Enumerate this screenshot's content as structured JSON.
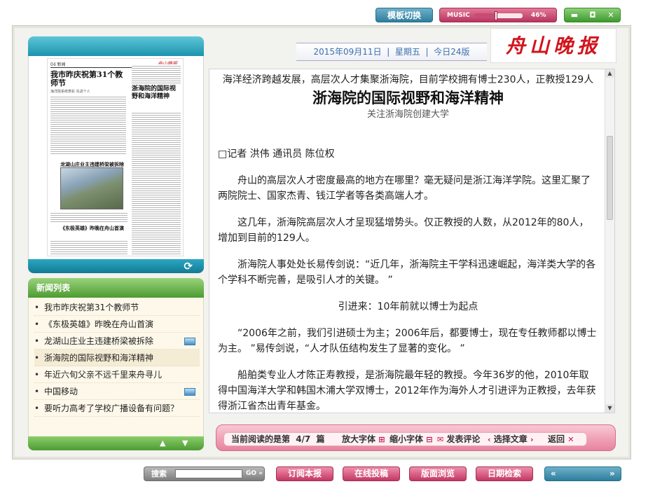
{
  "topbar": {
    "template_switch": "模板切换",
    "music_label": "MUSIC",
    "music_volume_text": "46%",
    "music_volume": 0.46,
    "win_minimize": "▬",
    "win_restore": "◘",
    "win_close": "✕"
  },
  "masthead": {
    "date": "2015年09月11日",
    "weekday": "星期五",
    "edition": "今日24版",
    "logo_text": "舟山晚报"
  },
  "thumbnail": {
    "page_label": "04 新闻",
    "headline": "我市昨庆祝第31个教师节",
    "subtitle": "海洋院系统表彰 先进个人",
    "side_headline": "浙海院的国际视野和海洋精神",
    "photo_caption": "龙湖山庄业主违建桥梁被拆除",
    "bottom_headline": "《东极英雄》昨晚在舟山首演",
    "refresh_icon": "⟳"
  },
  "news_list": {
    "title": "新闻列表",
    "items": [
      {
        "text": "我市昨庆祝第31个教师节",
        "has_image": false
      },
      {
        "text": "《东极英雄》昨晚在舟山首演",
        "has_image": false
      },
      {
        "text": "龙湖山庄业主违建桥梁被拆除",
        "has_image": true
      },
      {
        "text": "浙海院的国际视野和海洋精神",
        "has_image": false
      },
      {
        "text": "年近六旬父亲不远千里来舟寻儿",
        "has_image": false
      },
      {
        "text": "中国移动",
        "has_image": true
      },
      {
        "text": "要听力高考了学校广播设备有问题？",
        "has_image": false
      }
    ],
    "up_arrow": "▲",
    "down_arrow": "▼"
  },
  "article": {
    "intro": "海洋经济跨越发展，高层次人才集聚浙海院，目前学校拥有博士230人，正教授129人",
    "headline": "浙海院的国际视野和海洋精神",
    "subhead": "关注浙海院创建大学",
    "byline": "□记者 洪伟 通讯员 陈位权",
    "p1": "舟山的高层次人才密度最高的地方在哪里？毫无疑问是浙江海洋学院。这里汇聚了两院院士、国家杰青、钱江学者等各类高端人才。",
    "p2": "这几年，浙海院高层次人才呈现猛增势头。仅正教授的人数，从2012年的80人，增加到目前的129人。",
    "p3": "浙海院人事处处长易传剑说：“近几年，浙海院主干学科迅速崛起，海洋类大学的各个学科不断完善，是吸引人才的关键。 ”",
    "section": "引进来：10年前就以博士为起点",
    "p4": "“2006年之前，我们引进硕士为主；2006年后，都要博士，现在专任教师都以博士为主。 ”易传剑说，“人才队伍结构发生了显著的变化。 ”",
    "p5": "船舶类专业人才陈正寿教授，是浙海院最年轻的教授。今年36岁的他，2010年取得中国海洋大学和韩国木浦大学双博士，2012年作为海外人才引进评为正教授，去年获得浙江省杰出青年基金。"
  },
  "readbar": {
    "current_label": "当前阅读的是第",
    "current_page": "4/7",
    "unit": "篇",
    "enlarge": "放大字体",
    "shrink": "缩小字体",
    "comment": "发表评论",
    "choose": "选择文章",
    "back": "返回"
  },
  "bottombar": {
    "search_label": "搜索",
    "search_placeholder": "",
    "search_go": "GO »",
    "subscribe": "订阅本报",
    "submit": "在线投稿",
    "browse": "版面浏览",
    "date_search": "日期检索",
    "prev": "«",
    "next": "»"
  },
  "colors": {
    "accent_blue": "#2e7e9e",
    "accent_pink": "#c23863",
    "accent_green": "#4c9b32",
    "logo_red": "#d2141c"
  }
}
